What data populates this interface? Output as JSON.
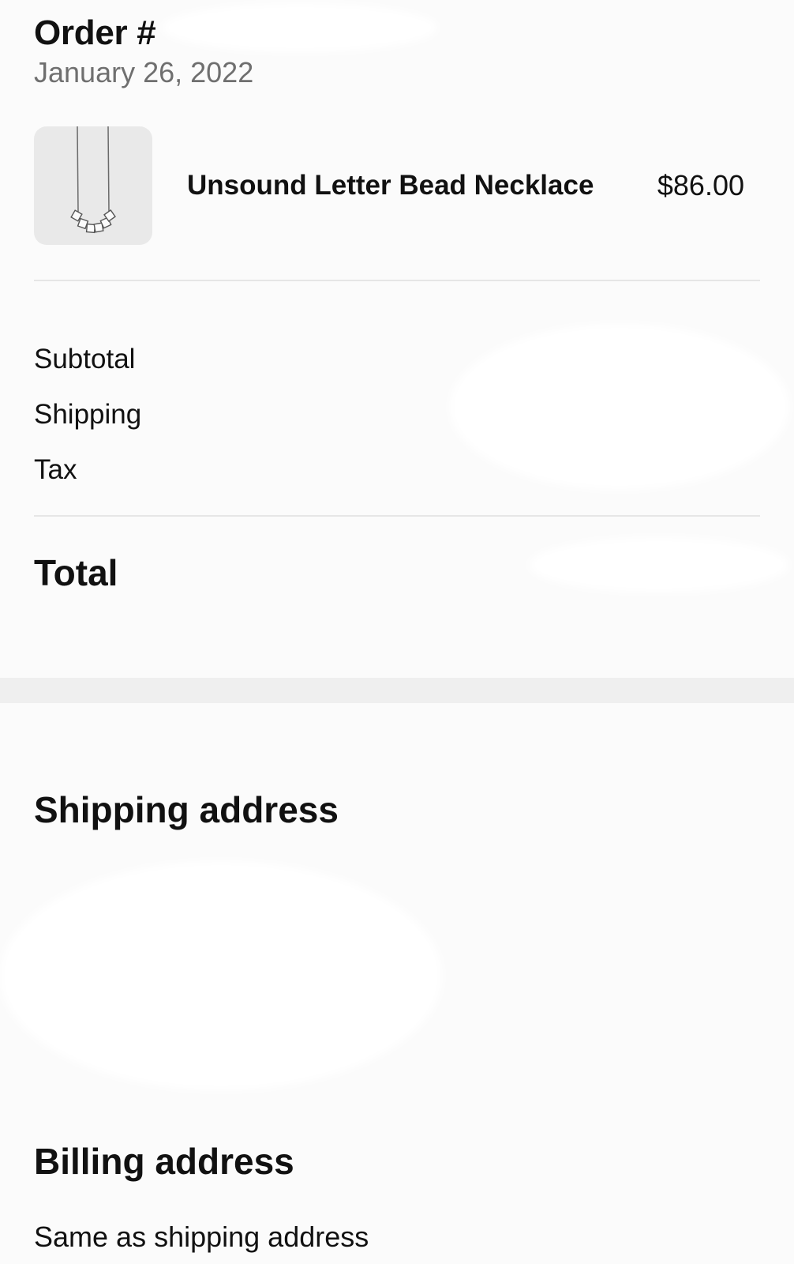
{
  "order": {
    "title": "Order #",
    "date": "January 26, 2022"
  },
  "item": {
    "name": "Unsound Letter Bead Necklace",
    "price": "$86.00",
    "thumbnail_icon": "necklace-image"
  },
  "summary": {
    "subtotal_label": "Subtotal",
    "shipping_label": "Shipping",
    "tax_label": "Tax",
    "total_label": "Total"
  },
  "shipping_address": {
    "heading": "Shipping address"
  },
  "billing_address": {
    "heading": "Billing address",
    "note": "Same as shipping address"
  },
  "colors": {
    "background": "#fbfbfb",
    "band": "#efefef",
    "divider": "#e6e6e6",
    "muted_text": "#6f6f6f"
  }
}
